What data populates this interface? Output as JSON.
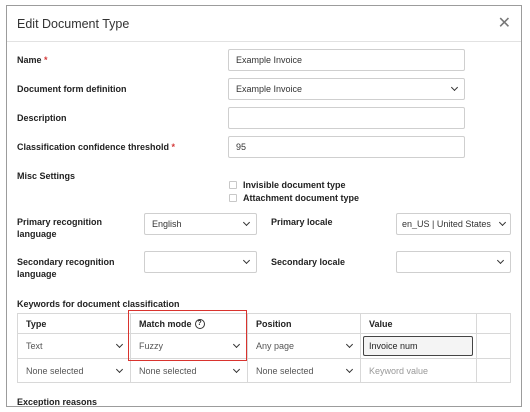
{
  "dialog": {
    "title": "Edit Document Type",
    "close_icon": "close-icon"
  },
  "fields": {
    "name": {
      "label": "Name",
      "required": "*",
      "value": "Example Invoice"
    },
    "form_definition": {
      "label": "Document form definition",
      "value": "Example Invoice"
    },
    "description": {
      "label": "Description",
      "value": ""
    },
    "threshold": {
      "label": "Classification confidence threshold",
      "required": "*",
      "value": "95"
    },
    "misc": {
      "label": "Misc Settings",
      "options": [
        "Invisible document type",
        "Attachment document type"
      ]
    },
    "primary_recognition": {
      "label": "Primary recognition language",
      "value": "English"
    },
    "primary_locale": {
      "label": "Primary locale",
      "value": "en_US | United States"
    },
    "secondary_recognition": {
      "label": "Secondary recognition language",
      "value": ""
    },
    "secondary_locale": {
      "label": "Secondary locale",
      "value": ""
    }
  },
  "keywords": {
    "label": "Keywords for document classification",
    "columns": [
      "Type",
      "Match mode",
      "Position",
      "Value"
    ],
    "help_icon": "?",
    "rows": [
      {
        "type": "Text",
        "match_mode": "Fuzzy",
        "position": "Any page",
        "value": "Invoice num"
      },
      {
        "type": "None selected",
        "match_mode": "None selected",
        "position": "None selected",
        "value_placeholder": "Keyword value"
      }
    ]
  },
  "exception": {
    "label": "Exception reasons"
  },
  "colors": {
    "required": "#d43a3a",
    "highlight": "#d9332e"
  }
}
